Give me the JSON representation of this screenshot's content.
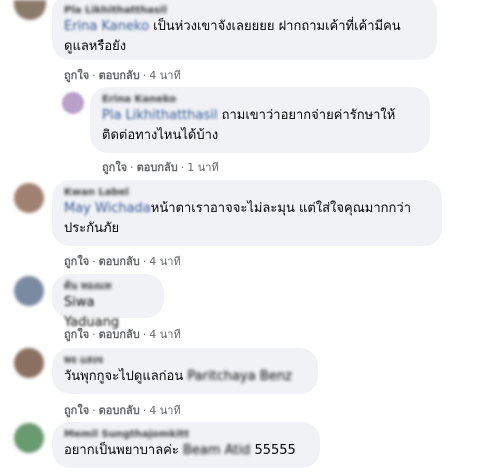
{
  "comments": [
    {
      "author": "Pla Likhithatthasil",
      "mention": "Erina Kaneko",
      "line1": " เป็นห่วงเขาจังเลยยยย ฝากถามเค้าที่เค้ามีคน",
      "line2": "ดูแลหรือยัง",
      "like": "ถูกใจ",
      "reply": "ตอบกลับ",
      "time": "4 นาที",
      "avatar_color": "#8a7a6a"
    },
    {
      "author": "Erina Kaneko",
      "mention": "Pla Likhithatthasil",
      "line1": " ถามเขาว่าอยากจ่ายค่ารักษาให้",
      "line2": "ติดต่อทางไหนได้บ้าง",
      "like": "ถูกใจ",
      "reply": "ตอบกลับ",
      "time": "1 นาที",
      "avatar_color": "#b8a0c8"
    },
    {
      "author": "Kwan Label",
      "mention": "May Wichada",
      "line1": "หน้าตาเราอาจจะไม่ละมุน แต่ใส่ใจคุณมากกว่า",
      "line2": "ประกันภัย",
      "like": "ถูกใจ",
      "reply": "ตอบกลับ",
      "time": "4 นาที",
      "avatar_color": "#a08070"
    },
    {
      "author": "ต้น ทองแท",
      "line1": "Siwa Yaduang",
      "like": "ถูกใจ",
      "reply": "ตอบกลับ",
      "time": "4 นาที",
      "avatar_color": "#7a8aa0"
    },
    {
      "author": "พจ แสงจ",
      "line1": "วันพุกกูจะไปดูแลก่อน ",
      "line1_blur": "Paritchaya Benz",
      "like": "ถูกใจ",
      "reply": "ตอบกลับ",
      "time": "4 นาที",
      "avatar_color": "#8a7060"
    },
    {
      "author": "Memil Sungthajomkitt",
      "line1": "อยากเป็นพยาบาลค่ะ ",
      "line1_blur": "Beam Atid",
      "line1_tail": " 55555",
      "avatar_color": "#6a9a70"
    }
  ]
}
